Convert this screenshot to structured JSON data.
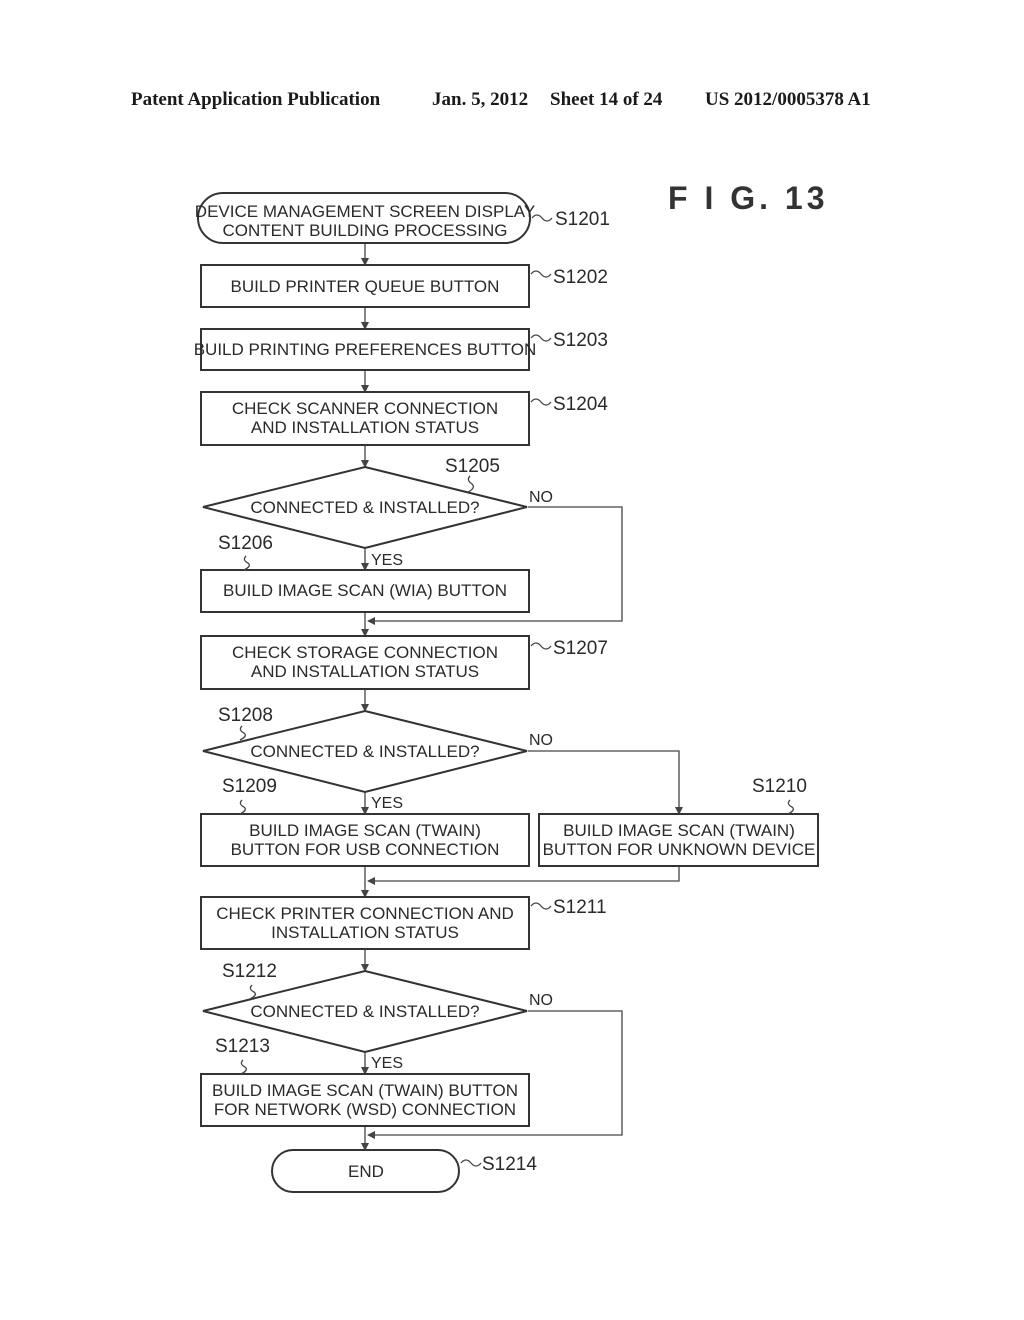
{
  "header": {
    "publication": "Patent Application Publication",
    "date": "Jan. 5, 2012",
    "sheet": "Sheet 14 of 24",
    "number": "US 2012/0005378 A1"
  },
  "figure_label": "F I G.  13",
  "nodes": {
    "s1201": {
      "id": "S1201",
      "type": "terminal",
      "lines": [
        "DEVICE MANAGEMENT SCREEN DISPLAY",
        "CONTENT BUILDING PROCESSING"
      ]
    },
    "s1202": {
      "id": "S1202",
      "type": "process",
      "lines": [
        "BUILD PRINTER QUEUE BUTTON"
      ]
    },
    "s1203": {
      "id": "S1203",
      "type": "process",
      "lines": [
        "BUILD PRINTING PREFERENCES BUTTON"
      ]
    },
    "s1204": {
      "id": "S1204",
      "type": "process",
      "lines": [
        "CHECK SCANNER CONNECTION",
        "AND INSTALLATION STATUS"
      ]
    },
    "s1205": {
      "id": "S1205",
      "type": "decision",
      "lines": [
        "CONNECTED & INSTALLED?"
      ]
    },
    "s1206": {
      "id": "S1206",
      "type": "process",
      "lines": [
        "BUILD IMAGE SCAN (WIA) BUTTON"
      ]
    },
    "s1207": {
      "id": "S1207",
      "type": "process",
      "lines": [
        "CHECK STORAGE CONNECTION",
        "AND INSTALLATION STATUS"
      ]
    },
    "s1208": {
      "id": "S1208",
      "type": "decision",
      "lines": [
        "CONNECTED & INSTALLED?"
      ]
    },
    "s1209": {
      "id": "S1209",
      "type": "process",
      "lines": [
        "BUILD IMAGE SCAN (TWAIN)",
        "BUTTON FOR USB CONNECTION"
      ]
    },
    "s1210": {
      "id": "S1210",
      "type": "process",
      "lines": [
        "BUILD IMAGE SCAN (TWAIN)",
        "BUTTON FOR UNKNOWN DEVICE"
      ]
    },
    "s1211": {
      "id": "S1211",
      "type": "process",
      "lines": [
        "CHECK PRINTER CONNECTION AND",
        "INSTALLATION STATUS"
      ]
    },
    "s1212": {
      "id": "S1212",
      "type": "decision",
      "lines": [
        "CONNECTED & INSTALLED?"
      ]
    },
    "s1213": {
      "id": "S1213",
      "type": "process",
      "lines": [
        "BUILD IMAGE SCAN (TWAIN) BUTTON",
        "FOR NETWORK (WSD) CONNECTION"
      ]
    },
    "s1214": {
      "id": "S1214",
      "type": "terminal",
      "lines": [
        "END"
      ]
    }
  },
  "branch_labels": {
    "yes": "YES",
    "no": "NO"
  }
}
